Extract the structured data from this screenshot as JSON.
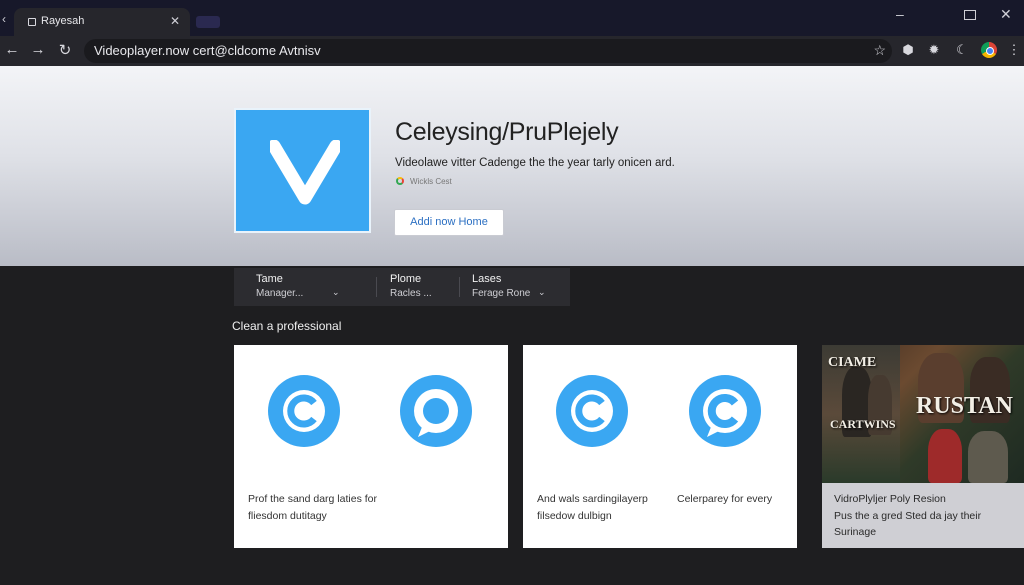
{
  "browser": {
    "tab_title": "Rayesah",
    "url": "Videoplayer.now cert@cldcome Avtnisv"
  },
  "app": {
    "title": "Celeysing/PruPlejely",
    "description": "Videolawe vitter Cadenge the the year tarly onicen ard.",
    "byline": "Wickls Cest",
    "add_button": "Addi now Home"
  },
  "info": [
    {
      "label": "Tame",
      "value": "Manager..."
    },
    {
      "label": "Plome",
      "value": "Racles ..."
    },
    {
      "label": "Lases",
      "value": "Ferage Rone"
    }
  ],
  "section_title": "Clean a professional",
  "cards": [
    {
      "captions": [
        "Prof the sand darg laties for fliesdom dutitagy"
      ]
    },
    {
      "captions": [
        "And wals sardingilayerp filsedow dulbign",
        "Celerparey for every"
      ]
    }
  ],
  "poster": {
    "text_top": "CIAME",
    "text_mid": "RUSTAN",
    "text_low": "CARTWINS",
    "caption_title": "VidroPlyljer Poly Resion",
    "caption_body": "Pus the a gred Sted da jay their Surinage"
  },
  "colors": {
    "accent": "#3aa7f2",
    "link": "#2b6fc2"
  },
  "icons": [
    "back-icon",
    "forward-icon",
    "reload-icon",
    "star-icon",
    "extension-icon",
    "settings-icon",
    "moon-icon",
    "chrome-icon",
    "close-icon",
    "chevron-down-icon",
    "chat-c-icon",
    "chat-o-icon"
  ]
}
